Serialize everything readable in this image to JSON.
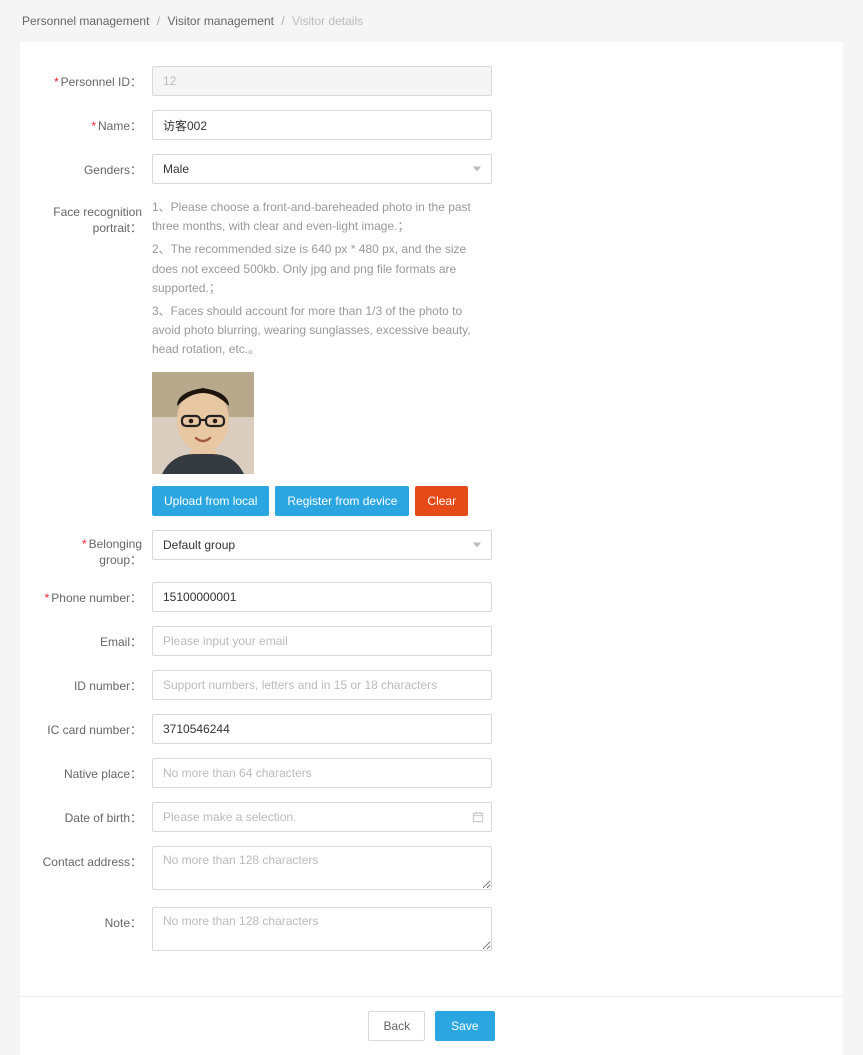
{
  "breadcrumb": {
    "a": "Personnel management",
    "b": "Visitor management",
    "c": "Visitor details"
  },
  "labels": {
    "personnel_id": "Personnel ID：",
    "name": "Name：",
    "genders": "Genders：",
    "face_portrait": "Face recognition portrait：",
    "belonging_group": "Belonging group：",
    "phone": "Phone number：",
    "email": "Email：",
    "id_number": "ID number：",
    "ic_card": "IC card number：",
    "native_place": "Native place：",
    "dob": "Date of birth：",
    "contact_address": "Contact address：",
    "note": "Note："
  },
  "values": {
    "personnel_id": "12",
    "name": "访客002",
    "gender": "Male",
    "belonging_group": "Default group",
    "phone": "15100000001",
    "email": "",
    "id_number": "",
    "ic_card": "3710546244",
    "native_place": "",
    "dob": "",
    "contact_address": "",
    "note": ""
  },
  "placeholders": {
    "email": "Please input your email",
    "id_number": "Support numbers, letters and in 15 or 18 characters",
    "native_place": "No more than 64 characters",
    "dob": "Please make a selection.",
    "contact_address": "No more than 128 characters",
    "note": "No more than 128 characters"
  },
  "hints": {
    "line1": "1、Please choose a front-and-bareheaded photo in the past three months, with clear and even-light image.；",
    "line2": "2、The recommended size is 640 px * 480 px, and the size does not exceed 500kb. Only jpg and png file formats are supported.；",
    "line3": "3、Faces should account for more than 1/3 of the photo to avoid photo blurring, wearing sunglasses, excessive beauty, head rotation, etc.。"
  },
  "buttons": {
    "upload": "Upload from local",
    "register": "Register from device",
    "clear": "Clear",
    "back": "Back",
    "save": "Save"
  }
}
